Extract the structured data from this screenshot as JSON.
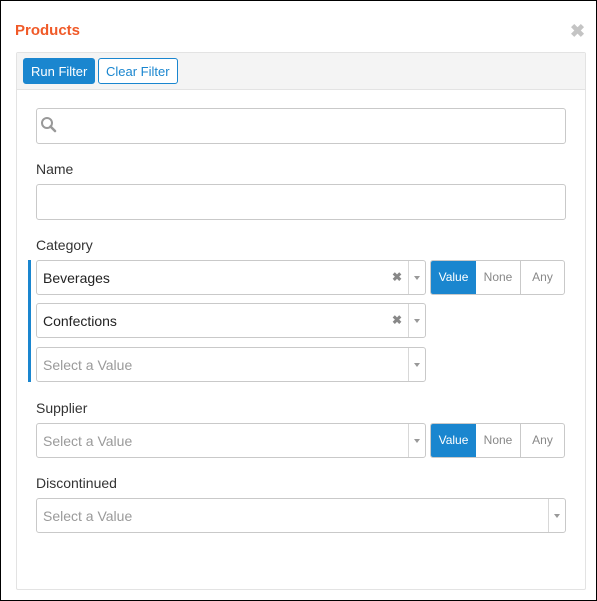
{
  "window": {
    "title": "Products",
    "close_icon": "close-icon"
  },
  "toolbar": {
    "run_filter_label": "Run Filter",
    "clear_filter_label": "Clear Filter"
  },
  "search": {
    "value": "",
    "icon": "search-icon"
  },
  "fields": {
    "name": {
      "label": "Name",
      "value": ""
    },
    "category": {
      "label": "Category",
      "selected": [
        "Beverages",
        "Confections"
      ],
      "placeholder": "Select a Value",
      "mode": {
        "options": [
          "Value",
          "None",
          "Any"
        ],
        "active": "Value"
      }
    },
    "supplier": {
      "label": "Supplier",
      "placeholder": "Select a Value",
      "mode": {
        "options": [
          "Value",
          "None",
          "Any"
        ],
        "active": "Value"
      }
    },
    "discontinued": {
      "label": "Discontinued",
      "placeholder": "Select a Value"
    }
  },
  "colors": {
    "title": "#f05a28",
    "accent": "#1a86cf"
  }
}
